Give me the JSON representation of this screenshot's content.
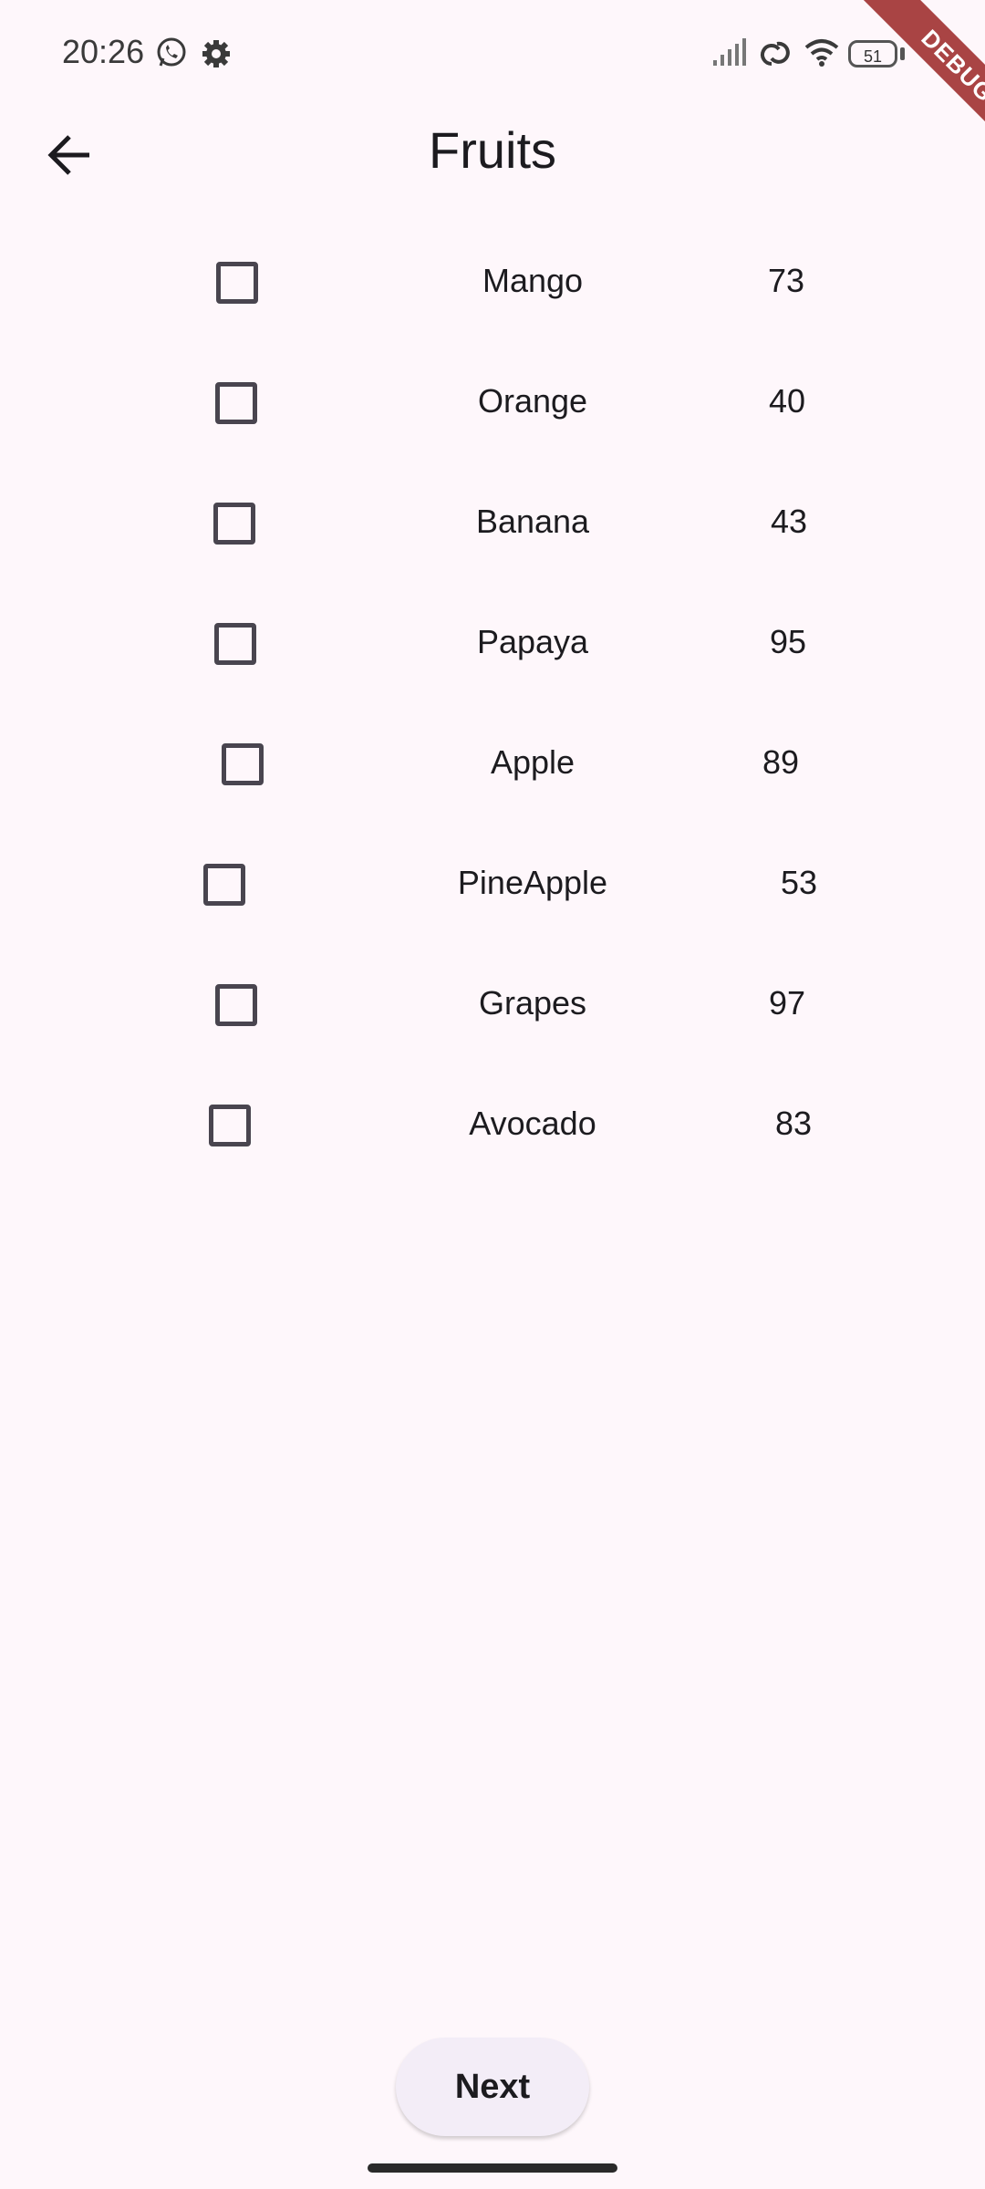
{
  "status_bar": {
    "time": "20:26",
    "battery_level": "51",
    "icons": [
      "whatsapp-icon",
      "gear-icon",
      "signal-icon",
      "link-icon",
      "wifi-icon",
      "battery-icon"
    ]
  },
  "debug_banner": "DEBUG",
  "app_bar": {
    "title": "Fruits",
    "back_icon": "arrow-back-icon"
  },
  "fruits": [
    {
      "name": "Mango",
      "value": "73",
      "checked": false
    },
    {
      "name": "Orange",
      "value": "40",
      "checked": false
    },
    {
      "name": "Banana",
      "value": "43",
      "checked": false
    },
    {
      "name": "Papaya",
      "value": "95",
      "checked": false
    },
    {
      "name": "Apple",
      "value": "89",
      "checked": false
    },
    {
      "name": "PineApple",
      "value": "53",
      "checked": false
    },
    {
      "name": "Grapes",
      "value": "97",
      "checked": false
    },
    {
      "name": "Avocado",
      "value": "83",
      "checked": false
    }
  ],
  "next_button": {
    "label": "Next"
  },
  "colors": {
    "background": "#fef7fb",
    "button_bg": "#f3edf7",
    "checkbox_border": "#49454f",
    "debug_banner": "#a94444"
  }
}
